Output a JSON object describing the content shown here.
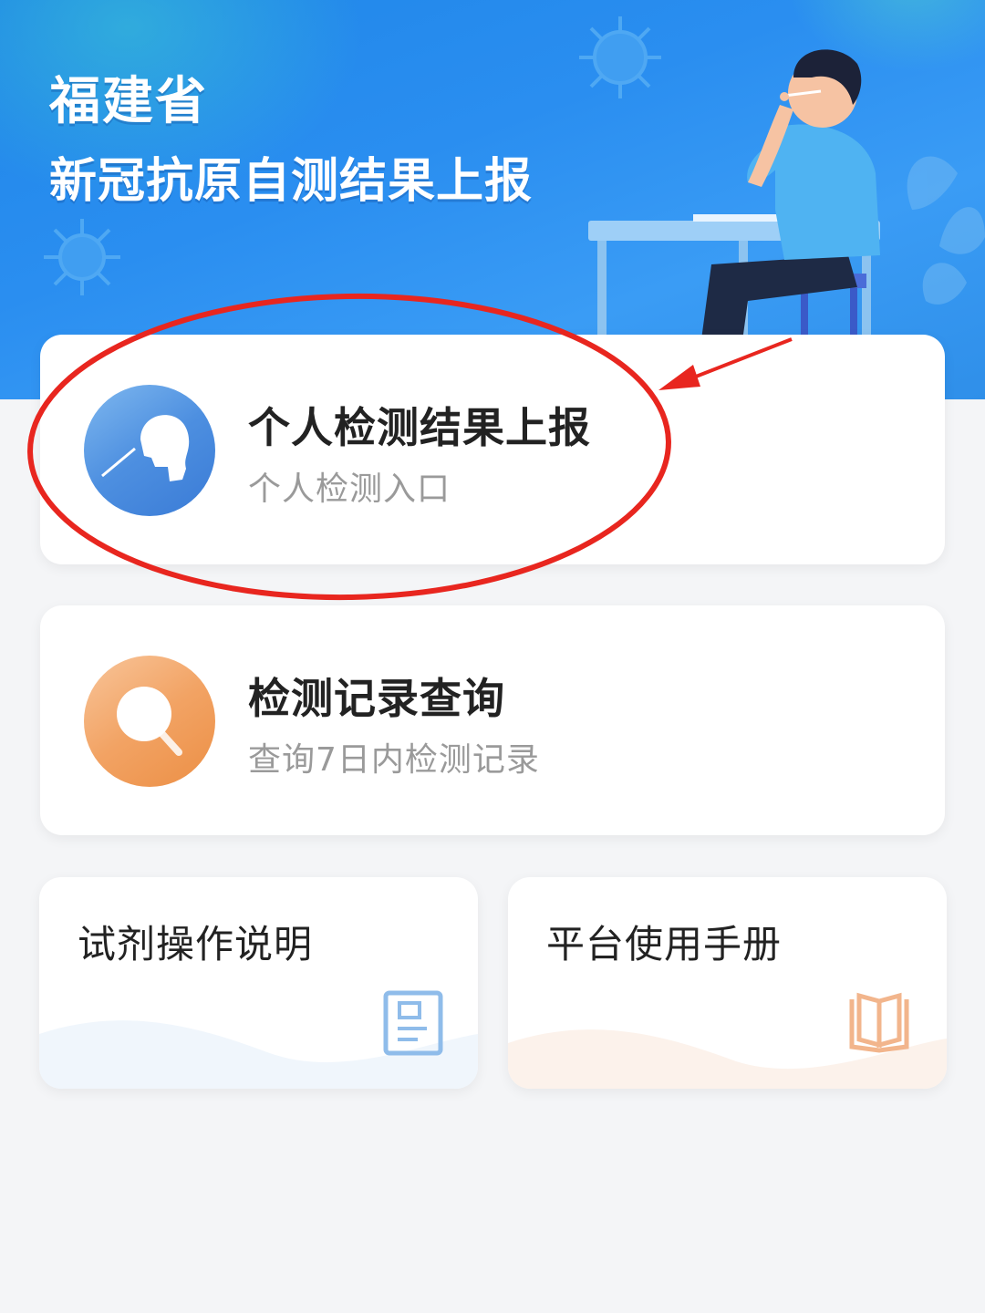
{
  "banner": {
    "title_line1": "福建省",
    "title_line2": "新冠抗原自测结果上报"
  },
  "cards": {
    "personal_report": {
      "title": "个人检测结果上报",
      "subtitle": "个人检测入口",
      "icon": "nasal-swab-icon"
    },
    "record_query": {
      "title": "检测记录查询",
      "subtitle": "查询7日内检测记录",
      "icon": "magnifier-icon"
    },
    "reagent_guide": {
      "title": "试剂操作说明",
      "icon": "document-icon"
    },
    "platform_manual": {
      "title": "平台使用手册",
      "icon": "open-book-icon"
    }
  },
  "colors": {
    "banner": "#2a8ef0",
    "annotation": "#e8261f",
    "blue_icon": "#4d8fe0",
    "orange_icon": "#f2a364"
  }
}
